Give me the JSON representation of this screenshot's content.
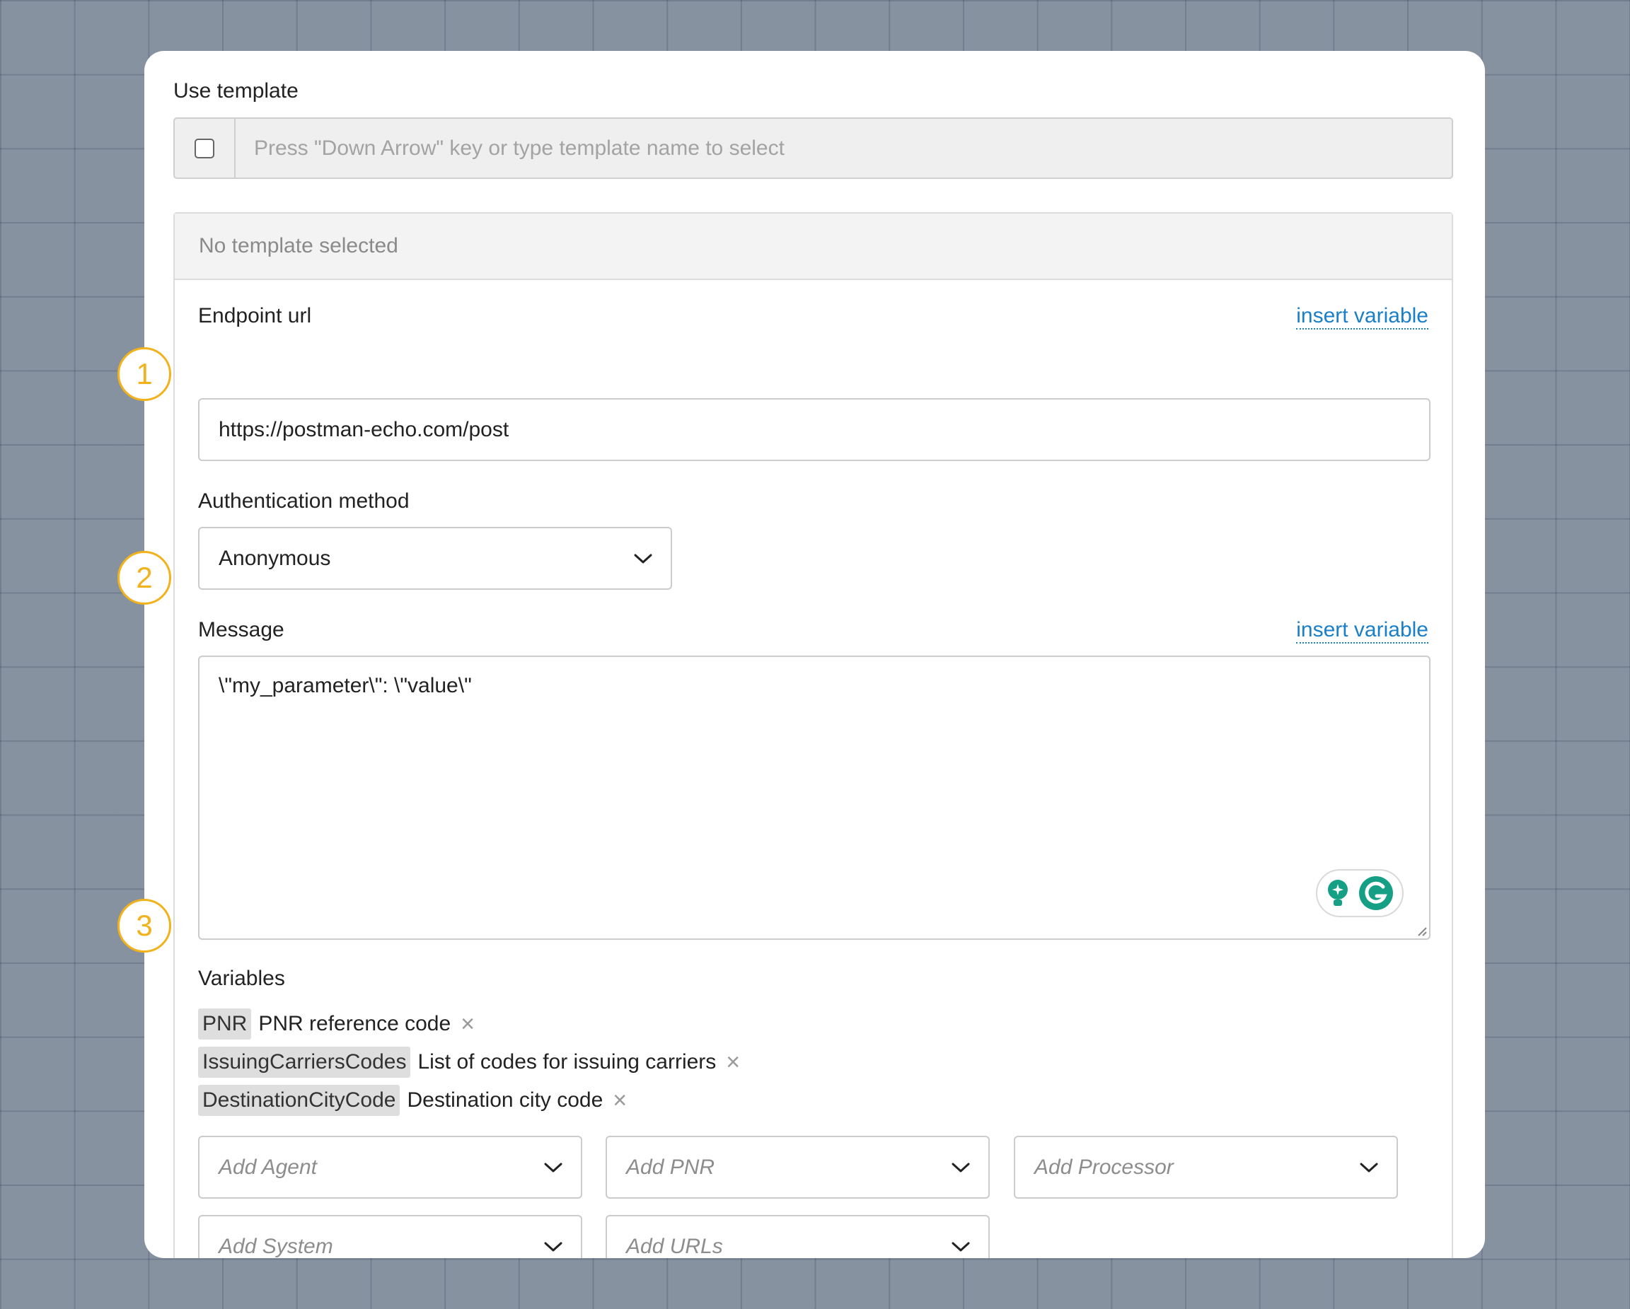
{
  "use_template": {
    "label": "Use template",
    "placeholder": "Press \"Down Arrow\" key or type template name to select"
  },
  "panel": {
    "header": "No template selected",
    "endpoint": {
      "label": "Endpoint url",
      "insert_variable": "insert variable",
      "value": "https://postman-echo.com/post"
    },
    "auth": {
      "label": "Authentication method",
      "value": "Anonymous"
    },
    "message": {
      "label": "Message",
      "insert_variable": "insert variable",
      "value": "\\\"my_parameter\\\": \\\"value\\\""
    },
    "variables": {
      "label": "Variables",
      "items": [
        {
          "name": "PNR",
          "description": "PNR reference code",
          "remove": "×"
        },
        {
          "name": "IssuingCarriersCodes",
          "description": "List of codes for issuing carriers",
          "remove": "×"
        },
        {
          "name": "DestinationCityCode",
          "description": "Destination city code",
          "remove": "×"
        }
      ]
    },
    "dropdowns": [
      {
        "placeholder": "Add Agent"
      },
      {
        "placeholder": "Add PNR"
      },
      {
        "placeholder": "Add Processor"
      },
      {
        "placeholder": "Add System"
      },
      {
        "placeholder": "Add URLs"
      }
    ]
  },
  "steps": [
    "1",
    "2",
    "3"
  ],
  "colors": {
    "background": "#8792a1",
    "accent_badge": "#f2b21c",
    "link": "#1a7fc9",
    "grammarly_green": "#15a085"
  }
}
